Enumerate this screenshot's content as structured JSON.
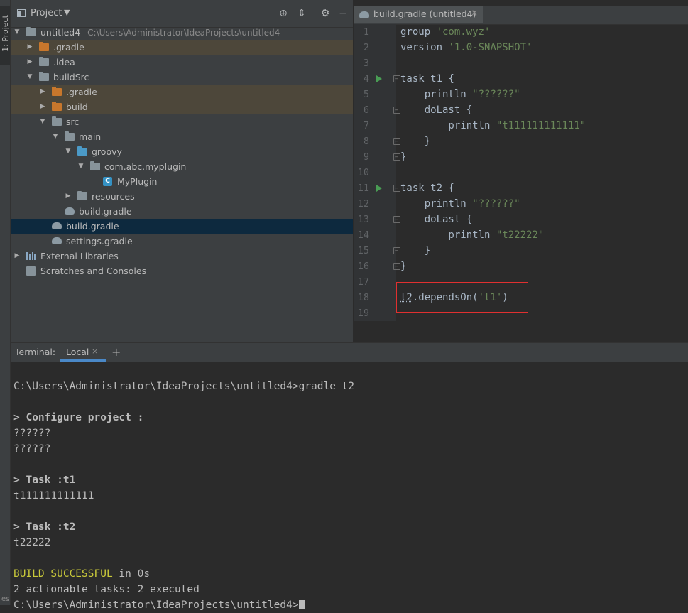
{
  "side_strip": {
    "label": "1: Project",
    "bottom_label": "es"
  },
  "project_panel": {
    "title": "Project",
    "header_icons": [
      "locate-icon",
      "collapse-icon",
      "gear-icon",
      "hide-icon"
    ],
    "tree": [
      {
        "label": "untitled4",
        "path": "C:\\Users\\Administrator\\IdeaProjects\\untitled4",
        "icon": "module-folder-icon",
        "expanded": true
      },
      {
        "label": ".gradle",
        "icon": "excluded-folder-icon",
        "expanded": false
      },
      {
        "label": ".idea",
        "icon": "folder-icon",
        "expanded": false
      },
      {
        "label": "buildSrc",
        "icon": "module-folder-icon",
        "expanded": true
      },
      {
        "label": ".gradle",
        "icon": "excluded-folder-icon",
        "expanded": false
      },
      {
        "label": "build",
        "icon": "excluded-folder-icon",
        "expanded": false
      },
      {
        "label": "src",
        "icon": "folder-icon",
        "expanded": true
      },
      {
        "label": "main",
        "icon": "folder-icon",
        "expanded": true
      },
      {
        "label": "groovy",
        "icon": "source-folder-icon",
        "expanded": true
      },
      {
        "label": "com.abc.myplugin",
        "icon": "package-icon",
        "expanded": true
      },
      {
        "label": "MyPlugin",
        "icon": "class-icon"
      },
      {
        "label": "resources",
        "icon": "resources-folder-icon",
        "expanded": false
      },
      {
        "label": "build.gradle",
        "icon": "gradle-icon"
      },
      {
        "label": "build.gradle",
        "icon": "gradle-icon",
        "selected": true
      },
      {
        "label": "settings.gradle",
        "icon": "gradle-icon"
      },
      {
        "label": "External Libraries",
        "icon": "libraries-icon",
        "expanded": false
      },
      {
        "label": "Scratches and Consoles",
        "icon": "scratches-icon"
      }
    ]
  },
  "editor": {
    "tab": {
      "label": "build.gradle (untitled4)",
      "close": "×"
    },
    "lines": [
      {
        "n": "1",
        "segments": [
          {
            "t": "group ",
            "c": "plain"
          },
          {
            "t": "'com.wyz'",
            "c": "str"
          }
        ]
      },
      {
        "n": "2",
        "segments": [
          {
            "t": "version ",
            "c": "plain"
          },
          {
            "t": "'1.0-SNAPSHOT'",
            "c": "str"
          }
        ]
      },
      {
        "n": "3",
        "segments": []
      },
      {
        "n": "4",
        "run": true,
        "fold": true,
        "segments": [
          {
            "t": "task t1 {",
            "c": "plain"
          }
        ]
      },
      {
        "n": "5",
        "segments": [
          {
            "t": "    println ",
            "c": "plain"
          },
          {
            "t": "\"??????\"",
            "c": "str"
          }
        ]
      },
      {
        "n": "6",
        "fold": true,
        "segments": [
          {
            "t": "    doLast {",
            "c": "plain"
          }
        ]
      },
      {
        "n": "7",
        "segments": [
          {
            "t": "        println ",
            "c": "plain"
          },
          {
            "t": "\"t111111111111\"",
            "c": "str"
          }
        ]
      },
      {
        "n": "8",
        "fold": true,
        "segments": [
          {
            "t": "    }",
            "c": "plain"
          }
        ]
      },
      {
        "n": "9",
        "fold": true,
        "segments": [
          {
            "t": "}",
            "c": "plain"
          }
        ]
      },
      {
        "n": "10",
        "segments": []
      },
      {
        "n": "11",
        "run": true,
        "fold": true,
        "segments": [
          {
            "t": "task t2 {",
            "c": "plain"
          }
        ]
      },
      {
        "n": "12",
        "segments": [
          {
            "t": "    println ",
            "c": "plain"
          },
          {
            "t": "\"??????\"",
            "c": "str"
          }
        ]
      },
      {
        "n": "13",
        "fold": true,
        "segments": [
          {
            "t": "    doLast {",
            "c": "plain"
          }
        ]
      },
      {
        "n": "14",
        "segments": [
          {
            "t": "        println ",
            "c": "plain"
          },
          {
            "t": "\"t22222\"",
            "c": "str"
          }
        ]
      },
      {
        "n": "15",
        "fold": true,
        "segments": [
          {
            "t": "    }",
            "c": "plain"
          }
        ]
      },
      {
        "n": "16",
        "fold": true,
        "segments": [
          {
            "t": "}",
            "c": "plain"
          }
        ]
      },
      {
        "n": "17",
        "segments": []
      },
      {
        "n": "18",
        "segments": [
          {
            "t": "t2",
            "c": "plain underline"
          },
          {
            "t": ".dependsOn(",
            "c": "plain"
          },
          {
            "t": "'t1'",
            "c": "str"
          },
          {
            "t": ")",
            "c": "plain"
          }
        ]
      },
      {
        "n": "19",
        "segments": []
      }
    ]
  },
  "terminal": {
    "label": "Terminal:",
    "tab": "Local",
    "tab_close": "×",
    "add": "+",
    "lines": [
      {
        "t": "",
        "c": ""
      },
      {
        "t": "C:\\Users\\Administrator\\IdeaProjects\\untitled4>gradle t2",
        "c": ""
      },
      {
        "t": "",
        "c": ""
      },
      {
        "t": "> Configure project :",
        "c": "bold"
      },
      {
        "t": "??????",
        "c": ""
      },
      {
        "t": "??????",
        "c": ""
      },
      {
        "t": "",
        "c": ""
      },
      {
        "t": "> Task :t1",
        "c": "bold"
      },
      {
        "t": "t111111111111",
        "c": ""
      },
      {
        "t": "",
        "c": ""
      },
      {
        "t": "> Task :t2",
        "c": "bold"
      },
      {
        "t": "t22222",
        "c": ""
      },
      {
        "t": "",
        "c": ""
      },
      {
        "t": "BUILD SUCCESSFUL",
        "c": "yellow",
        "rest": " in 0s"
      },
      {
        "t": "2 actionable tasks: 2 executed",
        "c": ""
      },
      {
        "t": "C:\\Users\\Administrator\\IdeaProjects\\untitled4>",
        "c": "",
        "cursor": true
      }
    ]
  }
}
